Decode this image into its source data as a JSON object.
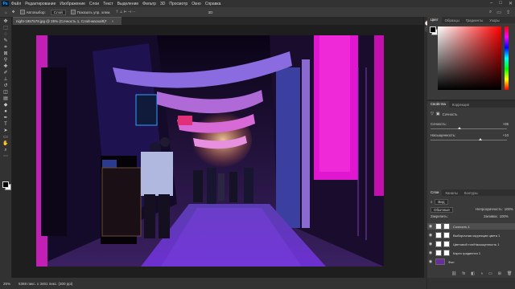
{
  "menu": {
    "logo": "Ps",
    "items": [
      "Файл",
      "Редактирование",
      "Изображение",
      "Слои",
      "Текст",
      "Выделение",
      "Фильтр",
      "3D",
      "Просмотр",
      "Окно",
      "Справка"
    ]
  },
  "window_controls": {
    "minimize": "–",
    "maximize": "□",
    "close": "✕"
  },
  "options": {
    "auto_select_label": "Автовыбор:",
    "auto_select_value": "Слой",
    "show_controls_label": "Показать упр. элем."
  },
  "document": {
    "tab_title": "night-1957578.jpg @ 25% (Сочность 1, Слой-маска/8)*",
    "close": "×"
  },
  "status": {
    "zoom": "25%",
    "doc_info": "5368 пикс. x 3461 пикс. (300 ppi)"
  },
  "color_panel": {
    "tabs": [
      "Цвет",
      "Образцы",
      "Градиенты",
      "Узоры"
    ],
    "active_tab": 0
  },
  "properties_panel": {
    "tabs": [
      "Свойства",
      "Коррекция"
    ],
    "active_tab": 0,
    "title": "Сочность",
    "vibrance_label": "Сочность:",
    "vibrance_value": "+85",
    "saturation_label": "Насыщенность:",
    "saturation_value": "+10"
  },
  "layers_panel": {
    "tabs": [
      "Слои",
      "Каналы",
      "Контуры"
    ],
    "active_tab": 0,
    "filter_label": "Вид",
    "blend_mode": "Обычные",
    "opacity_label": "Непрозрачность:",
    "opacity_value": "100%",
    "lock_label": "Закрепить:",
    "fill_label": "Заливка:",
    "fill_value": "100%",
    "layers": [
      {
        "name": "Сочность 1",
        "selected": true
      },
      {
        "name": "Выборочная коррекция цвета 1",
        "selected": false
      },
      {
        "name": "Цветовой тон/Насыщенность 1",
        "selected": false
      },
      {
        "name": "Карта градиента 1",
        "selected": false
      },
      {
        "name": "Фон",
        "selected": false
      }
    ]
  },
  "colors": {
    "accent": "#31a8ff",
    "panel": "#3a3a3a",
    "canvas_bg": "#1e1e1e"
  }
}
